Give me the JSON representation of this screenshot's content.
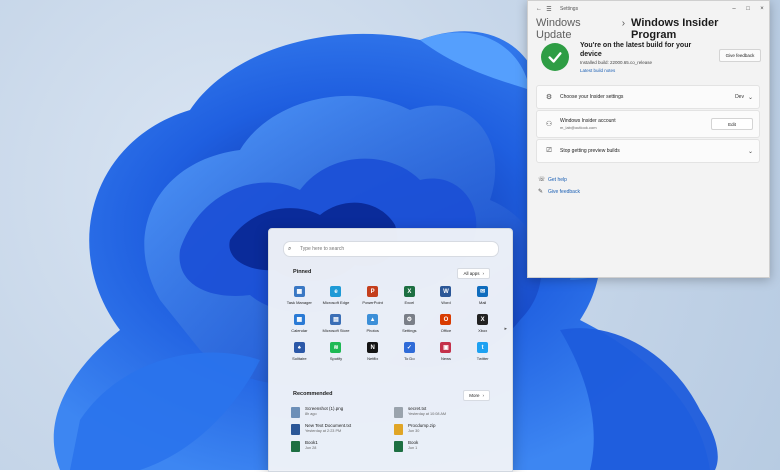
{
  "settings": {
    "title": "Settings",
    "breadcrumb_parent": "Windows Update",
    "breadcrumb_current": "Windows Insider Program",
    "update_title": "You're on the latest build for your device",
    "installed_build": "Installed build: 22000.65.co_release",
    "build_notes_link": "Latest build notes",
    "give_feedback_button": "Give feedback",
    "rows": {
      "insider_settings": {
        "label": "Choose your Insider settings",
        "value": "Dev"
      },
      "account": {
        "label": "Windows Insider account",
        "email": "m_lab@outlook.com",
        "button": "Edit"
      },
      "stop_preview": {
        "label": "Stop getting preview builds"
      }
    },
    "links": {
      "get_help": "Get help",
      "give_feedback": "Give feedback"
    }
  },
  "start": {
    "search_placeholder": "Type here to search",
    "pinned_title": "Pinned",
    "all_apps": "All apps",
    "apps": [
      {
        "name": "Task Manager",
        "color": "#3a78c4",
        "glyph": "▦"
      },
      {
        "name": "Microsoft Edge",
        "color": "#1e9ad6",
        "glyph": "e"
      },
      {
        "name": "PowerPoint",
        "color": "#c43e1c",
        "glyph": "P"
      },
      {
        "name": "Excel",
        "color": "#1d6f42",
        "glyph": "X"
      },
      {
        "name": "Word",
        "color": "#2b5797",
        "glyph": "W"
      },
      {
        "name": "Mail",
        "color": "#0f6cbd",
        "glyph": "✉"
      },
      {
        "name": "Calendar",
        "color": "#2a7ad5",
        "glyph": "▦"
      },
      {
        "name": "Microsoft Store",
        "color": "#3b6fb6",
        "glyph": "▤"
      },
      {
        "name": "Photos",
        "color": "#3c8fd8",
        "glyph": "▲"
      },
      {
        "name": "Settings",
        "color": "#7a7f88",
        "glyph": "⚙"
      },
      {
        "name": "Office",
        "color": "#d83b01",
        "glyph": "O"
      },
      {
        "name": "Xbox",
        "color": "#222222",
        "glyph": "X"
      },
      {
        "name": "Solitaire",
        "color": "#2b58a8",
        "glyph": "♠"
      },
      {
        "name": "Spotify",
        "color": "#1db954",
        "glyph": "≋"
      },
      {
        "name": "Netflix",
        "color": "#141414",
        "glyph": "N"
      },
      {
        "name": "To Do",
        "color": "#2f6bd8",
        "glyph": "✓"
      },
      {
        "name": "News",
        "color": "#c4314b",
        "glyph": "▣"
      },
      {
        "name": "Twitter",
        "color": "#1da1f2",
        "glyph": "t"
      }
    ],
    "recommended_title": "Recommended",
    "more_button": "More",
    "recommended": [
      {
        "name": "Screenshot (1).png",
        "time": "8h ago",
        "color": "#6d8fb8"
      },
      {
        "name": "secret.txt",
        "time": "Yesterday at 10:08 AM",
        "color": "#9aa3ad"
      },
      {
        "name": "New Text Document.txt",
        "time": "Yesterday at 2:23 PM",
        "color": "#2b5797"
      },
      {
        "name": "Procdump.zip",
        "time": "Jun 30",
        "color": "#e0a526"
      },
      {
        "name": "Book1",
        "time": "Jun 28",
        "color": "#1d6f42"
      },
      {
        "name": "Book",
        "time": "Jun 1",
        "color": "#1d6f42"
      }
    ]
  },
  "colors": {
    "accent": "#1a5fb4",
    "success": "#2e9d44",
    "wallpaper_blue": "#1f5fe0"
  }
}
